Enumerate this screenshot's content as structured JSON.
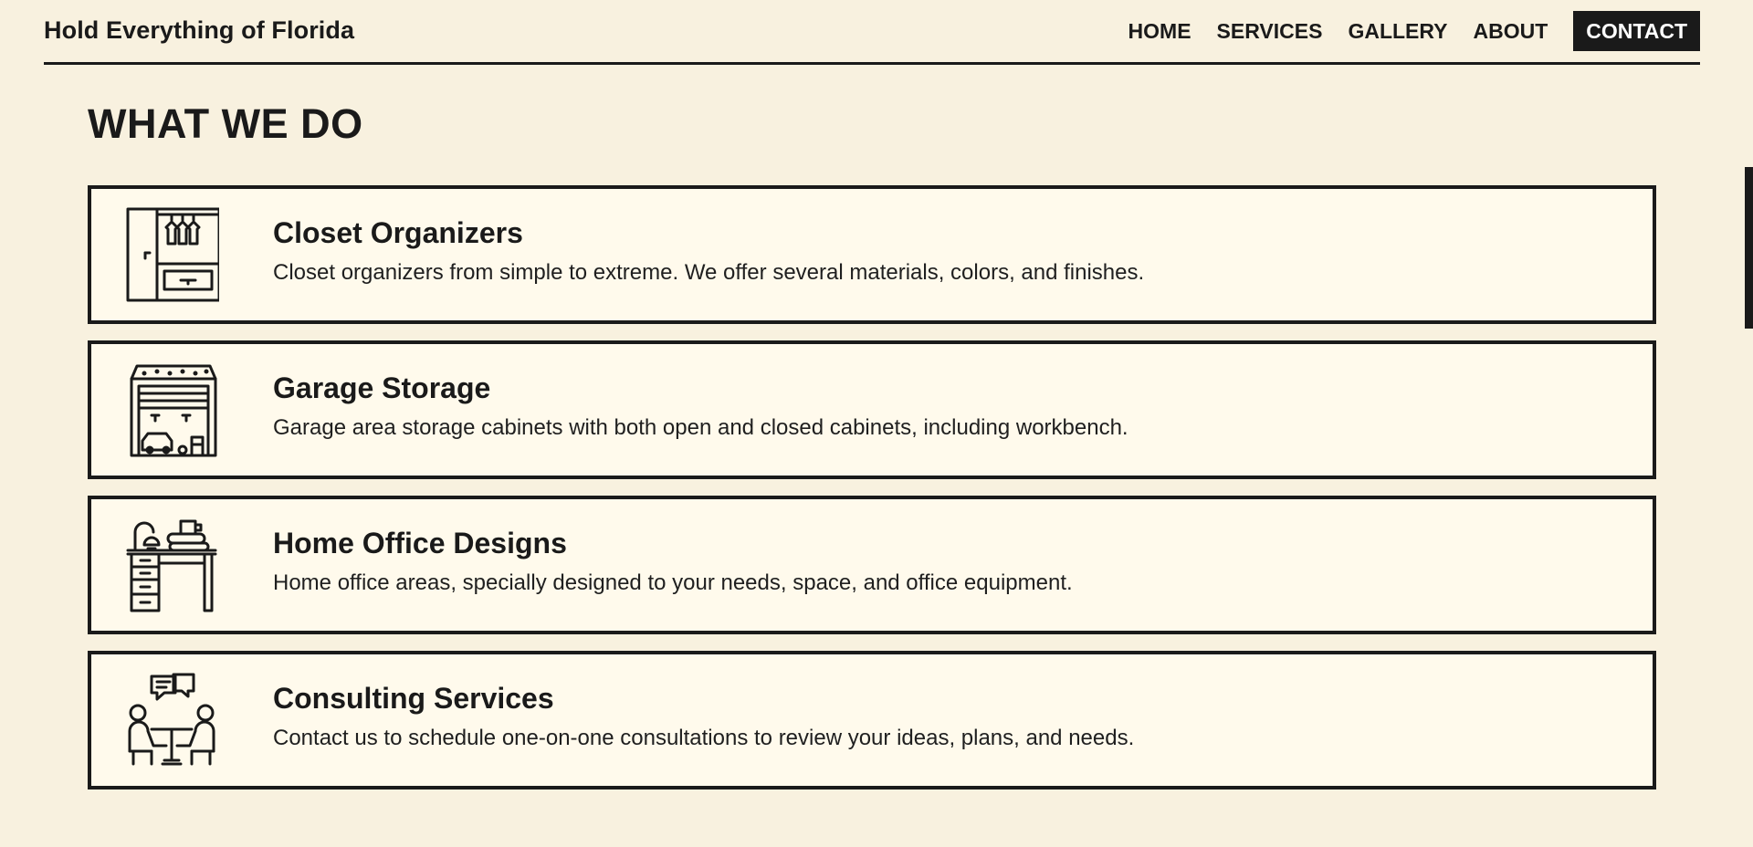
{
  "header": {
    "brand": "Hold Everything of Florida",
    "nav": [
      "HOME",
      "SERVICES",
      "GALLERY",
      "ABOUT",
      "CONTACT"
    ]
  },
  "section": {
    "title": "WHAT WE DO"
  },
  "services": [
    {
      "title": "Closet Organizers",
      "description": "Closet organizers from simple to extreme. We offer several materials, colors, and finishes.",
      "icon": "closet-icon"
    },
    {
      "title": "Garage Storage",
      "description": "Garage area storage cabinets with both open and closed cabinets, including workbench.",
      "icon": "garage-icon"
    },
    {
      "title": "Home Office Designs",
      "description": "Home office areas, specially designed to your needs, space, and office equipment.",
      "icon": "desk-icon"
    },
    {
      "title": "Consulting Services",
      "description": "Contact us to schedule one-on-one consultations to review your ideas, plans, and needs.",
      "icon": "consultation-icon"
    }
  ],
  "colors": {
    "background": "#f8f1df",
    "card_background": "#fffaec",
    "ink": "#1a1a1a",
    "cta_text": "#ffffff"
  }
}
